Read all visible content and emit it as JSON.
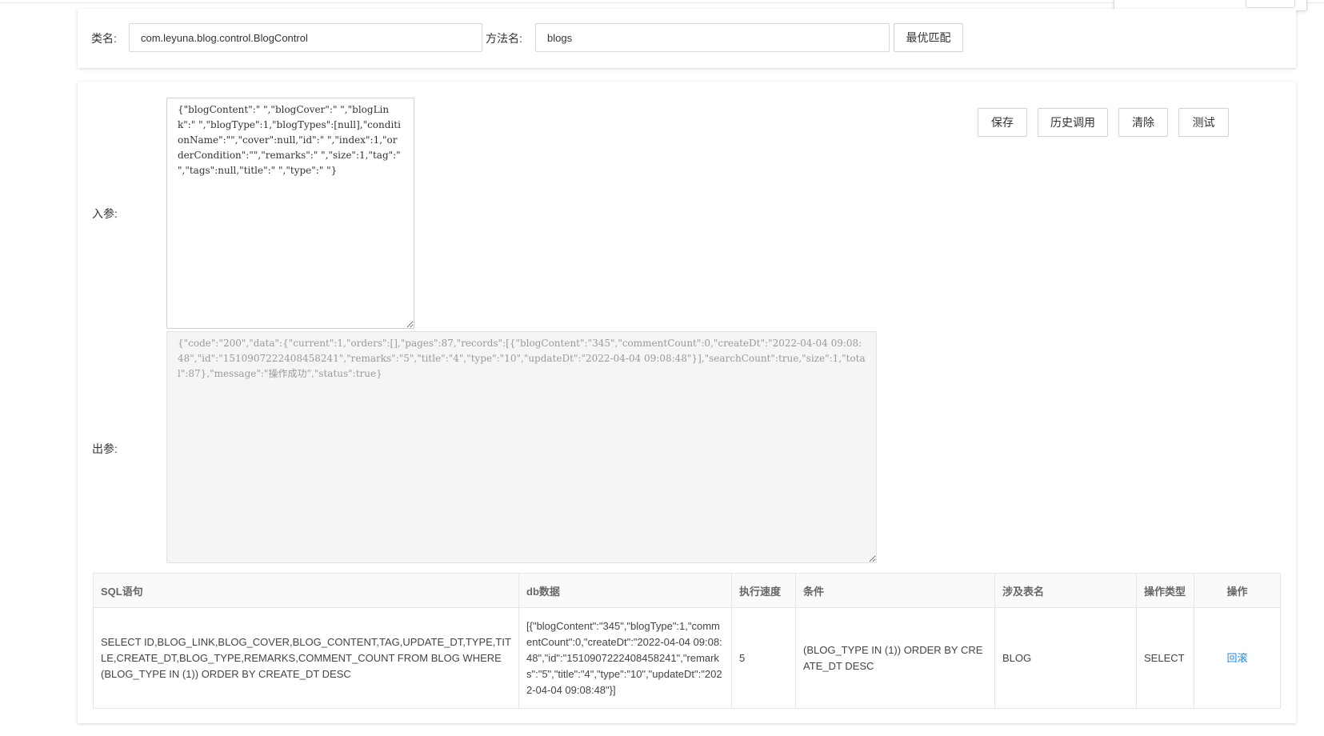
{
  "top": {
    "class_label": "类名:",
    "class_value": "com.leyuna.blog.control.BlogControl",
    "method_label": "方法名:",
    "method_value": "blogs",
    "best_match_button": "最优匹配"
  },
  "params": {
    "input_label": "入参:",
    "input_value": "{\"blogContent\":\" \",\"blogCover\":\" \",\"blogLink\":\" \",\"blogType\":1,\"blogTypes\":[null],\"conditionName\":\"\",\"cover\":null,\"id\":\" \",\"index\":1,\"orderCondition\":\"\",\"remarks\":\" \",\"size\":1,\"tag\":\" \",\"tags\":null,\"title\":\" \",\"type\":\" \"}",
    "output_label": "出参:",
    "output_value": "{\"code\":\"200\",\"data\":{\"current\":1,\"orders\":[],\"pages\":87,\"records\":[{\"blogContent\":\"345\",\"commentCount\":0,\"createDt\":\"2022-04-04 09:08:48\",\"id\":\"1510907222408458241\",\"remarks\":\"5\",\"title\":\"4\",\"type\":\"10\",\"updateDt\":\"2022-04-04 09:08:48\"}],\"searchCount\":true,\"size\":1,\"total\":87},\"message\":\"操作成功\",\"status\":true}"
  },
  "actions": {
    "save": "保存",
    "history": "历史调用",
    "clear": "清除",
    "test": "测试"
  },
  "table": {
    "headers": [
      "SQL语句",
      "db数据",
      "执行速度",
      "条件",
      "涉及表名",
      "操作类型",
      "操作"
    ],
    "rows": [
      {
        "sql": "SELECT ID,BLOG_LINK,BLOG_COVER,BLOG_CONTENT,TAG,UPDATE_DT,TYPE,TITLE,CREATE_DT,BLOG_TYPE,REMARKS,COMMENT_COUNT FROM BLOG WHERE (BLOG_TYPE IN (1)) ORDER BY CREATE_DT DESC",
        "db_data": "[{\"blogContent\":\"345\",\"blogType\":1,\"commentCount\":0,\"createDt\":\"2022-04-04 09:08:48\",\"id\":\"1510907222408458241\",\"remarks\":\"5\",\"title\":\"4\",\"type\":\"10\",\"updateDt\":\"2022-04-04 09:08:48\"}]",
        "speed": "5",
        "condition": "(BLOG_TYPE IN (1)) ORDER BY CREATE_DT DESC",
        "table_name": "BLOG",
        "op_type": "SELECT",
        "action": "回滚"
      }
    ]
  },
  "colors": {
    "link": "#1e88e5",
    "border": "#d9d9d9",
    "readonly_bg": "#f4f5f7"
  }
}
